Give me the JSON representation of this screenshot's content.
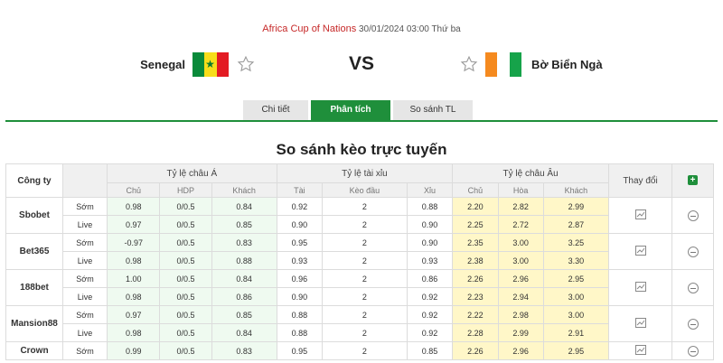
{
  "match": {
    "league": "Africa Cup of Nations",
    "datetime": "30/01/2024 03:00 Thứ ba",
    "home_team": "Senegal",
    "away_team": "Bờ Biển Ngà",
    "vs_label": "VS"
  },
  "tabs": [
    "Chi tiết",
    "Phân tích",
    "So sánh TL"
  ],
  "section_title": "So sánh kèo trực tuyến",
  "table": {
    "company_header": "Công ty",
    "group_headers": [
      "Tỷ lệ châu Á",
      "Tỷ lệ tài xỉu",
      "Tỷ lệ châu Âu"
    ],
    "change_header": "Thay đổi",
    "sub_headers": [
      "Chủ",
      "HDP",
      "Khách",
      "Tài",
      "Kèo đầu",
      "Xỉu",
      "Chủ",
      "Hòa",
      "Khách"
    ],
    "companies": [
      {
        "name": "Sbobet",
        "rows": [
          {
            "type": "Sớm",
            "values": [
              "0.98",
              "0/0.5",
              "0.84",
              "0.92",
              "2",
              "0.88",
              "2.20",
              "2.82",
              "2.99"
            ]
          },
          {
            "type": "Live",
            "values": [
              "0.97",
              "0/0.5",
              "0.85",
              "0.90",
              "2",
              "0.90",
              "2.25",
              "2.72",
              "2.87"
            ]
          }
        ]
      },
      {
        "name": "Bet365",
        "rows": [
          {
            "type": "Sớm",
            "values": [
              "-0.97",
              "0/0.5",
              "0.83",
              "0.95",
              "2",
              "0.90",
              "2.35",
              "3.00",
              "3.25"
            ]
          },
          {
            "type": "Live",
            "values": [
              "0.98",
              "0/0.5",
              "0.88",
              "0.93",
              "2",
              "0.93",
              "2.38",
              "3.00",
              "3.30"
            ]
          }
        ]
      },
      {
        "name": "188bet",
        "rows": [
          {
            "type": "Sớm",
            "values": [
              "1.00",
              "0/0.5",
              "0.84",
              "0.96",
              "2",
              "0.86",
              "2.26",
              "2.96",
              "2.95"
            ]
          },
          {
            "type": "Live",
            "values": [
              "0.98",
              "0/0.5",
              "0.86",
              "0.90",
              "2",
              "0.92",
              "2.23",
              "2.94",
              "3.00"
            ]
          }
        ]
      },
      {
        "name": "Mansion88",
        "rows": [
          {
            "type": "Sớm",
            "values": [
              "0.97",
              "0/0.5",
              "0.85",
              "0.88",
              "2",
              "0.92",
              "2.22",
              "2.98",
              "3.00"
            ]
          },
          {
            "type": "Live",
            "values": [
              "0.98",
              "0/0.5",
              "0.84",
              "0.88",
              "2",
              "0.92",
              "2.28",
              "2.99",
              "2.91"
            ]
          }
        ]
      },
      {
        "name": "Crown",
        "rows": [
          {
            "type": "Sớm",
            "values": [
              "0.99",
              "0/0.5",
              "0.83",
              "0.95",
              "2",
              "0.85",
              "2.26",
              "2.96",
              "2.95"
            ]
          }
        ]
      }
    ]
  },
  "colors": {
    "accent_green": "#1f8f3b",
    "league_red": "#c62828",
    "asia_bg": "#effaf0",
    "eu_bg": "#fff7c8"
  }
}
